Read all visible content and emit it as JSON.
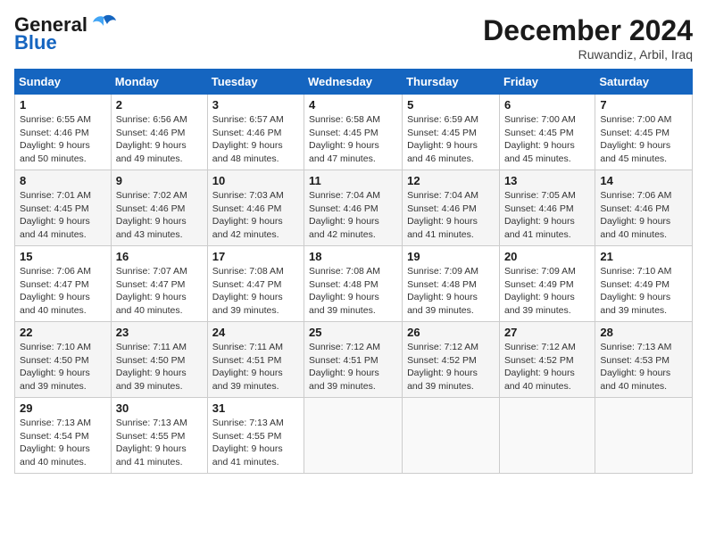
{
  "header": {
    "logo_line1": "General",
    "logo_line2": "Blue",
    "month_title": "December 2024",
    "location": "Ruwandiz, Arbil, Iraq"
  },
  "days_of_week": [
    "Sunday",
    "Monday",
    "Tuesday",
    "Wednesday",
    "Thursday",
    "Friday",
    "Saturday"
  ],
  "weeks": [
    [
      {
        "day": "1",
        "sunrise": "Sunrise: 6:55 AM",
        "sunset": "Sunset: 4:46 PM",
        "daylight": "Daylight: 9 hours and 50 minutes."
      },
      {
        "day": "2",
        "sunrise": "Sunrise: 6:56 AM",
        "sunset": "Sunset: 4:46 PM",
        "daylight": "Daylight: 9 hours and 49 minutes."
      },
      {
        "day": "3",
        "sunrise": "Sunrise: 6:57 AM",
        "sunset": "Sunset: 4:46 PM",
        "daylight": "Daylight: 9 hours and 48 minutes."
      },
      {
        "day": "4",
        "sunrise": "Sunrise: 6:58 AM",
        "sunset": "Sunset: 4:45 PM",
        "daylight": "Daylight: 9 hours and 47 minutes."
      },
      {
        "day": "5",
        "sunrise": "Sunrise: 6:59 AM",
        "sunset": "Sunset: 4:45 PM",
        "daylight": "Daylight: 9 hours and 46 minutes."
      },
      {
        "day": "6",
        "sunrise": "Sunrise: 7:00 AM",
        "sunset": "Sunset: 4:45 PM",
        "daylight": "Daylight: 9 hours and 45 minutes."
      },
      {
        "day": "7",
        "sunrise": "Sunrise: 7:00 AM",
        "sunset": "Sunset: 4:45 PM",
        "daylight": "Daylight: 9 hours and 45 minutes."
      }
    ],
    [
      {
        "day": "8",
        "sunrise": "Sunrise: 7:01 AM",
        "sunset": "Sunset: 4:45 PM",
        "daylight": "Daylight: 9 hours and 44 minutes."
      },
      {
        "day": "9",
        "sunrise": "Sunrise: 7:02 AM",
        "sunset": "Sunset: 4:46 PM",
        "daylight": "Daylight: 9 hours and 43 minutes."
      },
      {
        "day": "10",
        "sunrise": "Sunrise: 7:03 AM",
        "sunset": "Sunset: 4:46 PM",
        "daylight": "Daylight: 9 hours and 42 minutes."
      },
      {
        "day": "11",
        "sunrise": "Sunrise: 7:04 AM",
        "sunset": "Sunset: 4:46 PM",
        "daylight": "Daylight: 9 hours and 42 minutes."
      },
      {
        "day": "12",
        "sunrise": "Sunrise: 7:04 AM",
        "sunset": "Sunset: 4:46 PM",
        "daylight": "Daylight: 9 hours and 41 minutes."
      },
      {
        "day": "13",
        "sunrise": "Sunrise: 7:05 AM",
        "sunset": "Sunset: 4:46 PM",
        "daylight": "Daylight: 9 hours and 41 minutes."
      },
      {
        "day": "14",
        "sunrise": "Sunrise: 7:06 AM",
        "sunset": "Sunset: 4:46 PM",
        "daylight": "Daylight: 9 hours and 40 minutes."
      }
    ],
    [
      {
        "day": "15",
        "sunrise": "Sunrise: 7:06 AM",
        "sunset": "Sunset: 4:47 PM",
        "daylight": "Daylight: 9 hours and 40 minutes."
      },
      {
        "day": "16",
        "sunrise": "Sunrise: 7:07 AM",
        "sunset": "Sunset: 4:47 PM",
        "daylight": "Daylight: 9 hours and 40 minutes."
      },
      {
        "day": "17",
        "sunrise": "Sunrise: 7:08 AM",
        "sunset": "Sunset: 4:47 PM",
        "daylight": "Daylight: 9 hours and 39 minutes."
      },
      {
        "day": "18",
        "sunrise": "Sunrise: 7:08 AM",
        "sunset": "Sunset: 4:48 PM",
        "daylight": "Daylight: 9 hours and 39 minutes."
      },
      {
        "day": "19",
        "sunrise": "Sunrise: 7:09 AM",
        "sunset": "Sunset: 4:48 PM",
        "daylight": "Daylight: 9 hours and 39 minutes."
      },
      {
        "day": "20",
        "sunrise": "Sunrise: 7:09 AM",
        "sunset": "Sunset: 4:49 PM",
        "daylight": "Daylight: 9 hours and 39 minutes."
      },
      {
        "day": "21",
        "sunrise": "Sunrise: 7:10 AM",
        "sunset": "Sunset: 4:49 PM",
        "daylight": "Daylight: 9 hours and 39 minutes."
      }
    ],
    [
      {
        "day": "22",
        "sunrise": "Sunrise: 7:10 AM",
        "sunset": "Sunset: 4:50 PM",
        "daylight": "Daylight: 9 hours and 39 minutes."
      },
      {
        "day": "23",
        "sunrise": "Sunrise: 7:11 AM",
        "sunset": "Sunset: 4:50 PM",
        "daylight": "Daylight: 9 hours and 39 minutes."
      },
      {
        "day": "24",
        "sunrise": "Sunrise: 7:11 AM",
        "sunset": "Sunset: 4:51 PM",
        "daylight": "Daylight: 9 hours and 39 minutes."
      },
      {
        "day": "25",
        "sunrise": "Sunrise: 7:12 AM",
        "sunset": "Sunset: 4:51 PM",
        "daylight": "Daylight: 9 hours and 39 minutes."
      },
      {
        "day": "26",
        "sunrise": "Sunrise: 7:12 AM",
        "sunset": "Sunset: 4:52 PM",
        "daylight": "Daylight: 9 hours and 39 minutes."
      },
      {
        "day": "27",
        "sunrise": "Sunrise: 7:12 AM",
        "sunset": "Sunset: 4:52 PM",
        "daylight": "Daylight: 9 hours and 40 minutes."
      },
      {
        "day": "28",
        "sunrise": "Sunrise: 7:13 AM",
        "sunset": "Sunset: 4:53 PM",
        "daylight": "Daylight: 9 hours and 40 minutes."
      }
    ],
    [
      {
        "day": "29",
        "sunrise": "Sunrise: 7:13 AM",
        "sunset": "Sunset: 4:54 PM",
        "daylight": "Daylight: 9 hours and 40 minutes."
      },
      {
        "day": "30",
        "sunrise": "Sunrise: 7:13 AM",
        "sunset": "Sunset: 4:55 PM",
        "daylight": "Daylight: 9 hours and 41 minutes."
      },
      {
        "day": "31",
        "sunrise": "Sunrise: 7:13 AM",
        "sunset": "Sunset: 4:55 PM",
        "daylight": "Daylight: 9 hours and 41 minutes."
      },
      null,
      null,
      null,
      null
    ]
  ]
}
